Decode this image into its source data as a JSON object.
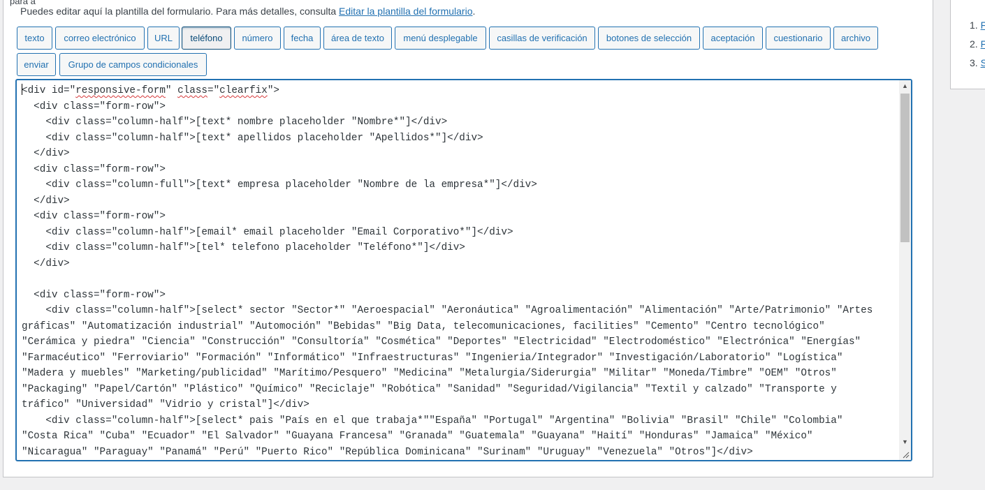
{
  "intro": {
    "text": "Puedes editar aquí la plantilla del formulario. Para más detalles, consulta ",
    "link": "Editar la plantilla del formulario",
    "suffix": "."
  },
  "tag_buttons": [
    {
      "label": "texto"
    },
    {
      "label": "correo electrónico"
    },
    {
      "label": "URL"
    },
    {
      "label": "teléfono"
    },
    {
      "label": "número"
    },
    {
      "label": "fecha"
    },
    {
      "label": "área de texto"
    },
    {
      "label": "menú desplegable"
    },
    {
      "label": "casillas de verificación"
    },
    {
      "label": "botones de selección"
    },
    {
      "label": "aceptación"
    },
    {
      "label": "cuestionario"
    },
    {
      "label": "archivo"
    },
    {
      "label": "enviar"
    },
    {
      "label": "Grupo de campos condicionales"
    }
  ],
  "active_button": "teléfono",
  "editor": {
    "first_line": {
      "a": "<div id=\"",
      "b": "responsive-form",
      "c": "\" ",
      "d": "class",
      "e": "=\"",
      "f": "clearfix",
      "g": "\">"
    },
    "lines": [
      "  <div class=\"form-row\">",
      "    <div class=\"column-half\">[text* nombre placeholder \"Nombre*\"]</div>",
      "    <div class=\"column-half\">[text* apellidos placeholder \"Apellidos*\"]</div>",
      "  </div>",
      "  <div class=\"form-row\">",
      "    <div class=\"column-full\">[text* empresa placeholder \"Nombre de la empresa*\"]</div>",
      "  </div>",
      "  <div class=\"form-row\">",
      "    <div class=\"column-half\">[email* email placeholder \"Email Corporativo*\"]</div>",
      "    <div class=\"column-half\">[tel* telefono placeholder \"Teléfono*\"]</div>",
      "  </div>",
      "",
      "  <div class=\"form-row\">",
      "    <div class=\"column-half\">[select* sector \"Sector*\" \"Aeroespacial\" \"Aeronáutica\" \"Agroalimentación\" \"Alimentación\" \"Arte/Patrimonio\" \"Artes",
      "gráficas\" \"Automatización industrial\" \"Automoción\" \"Bebidas\" \"Big Data, telecomunicaciones, facilities\" \"Cemento\" \"Centro tecnológico\"",
      "\"Cerámica y piedra\" \"Ciencia\" \"Construcción\" \"Consultoría\" \"Cosmética\" \"Deportes\" \"Electricidad\" \"Electrodoméstico\" \"Electrónica\" \"Energías\"",
      "\"Farmacéutico\" \"Ferroviario\" \"Formación\" \"Informático\" \"Infraestructuras\" \"Ingenieria/Integrador\" \"Investigación/Laboratorio\" \"Logística\"",
      "\"Madera y muebles\" \"Marketing/publicidad\" \"Marítimo/Pesquero\" \"Medicina\" \"Metalurgia/Siderurgia\" \"Militar\" \"Moneda/Timbre\" \"OEM\" \"Otros\"",
      "\"Packaging\" \"Papel/Cartón\" \"Plástico\" \"Químico\" \"Reciclaje\" \"Robótica\" \"Sanidad\" \"Seguridad/Vigilancia\" \"Textil y calzado\" \"Transporte y",
      "tráfico\" \"Universidad\" \"Vidrio y cristal\"]</div>",
      "    <div class=\"column-half\">[select* pais \"País en el que trabaja*\"\"España\" \"Portugal\" \"Argentina\" \"Bolivia\" \"Brasil\" \"Chile\" \"Colombia\"",
      "\"Costa Rica\" \"Cuba\" \"Ecuador\" \"El Salvador\" \"Guayana Francesa\" \"Granada\" \"Guatemala\" \"Guayana\" \"Haití\" \"Honduras\" \"Jamaica\" \"México\"",
      "\"Nicaragua\" \"Paraguay\" \"Panamá\" \"Perú\" \"Puerto Rico\" \"República Dominicana\" \"Surinam\" \"Uruguay\" \"Venezuela\" \"Otros\"]</div>"
    ]
  },
  "sidebar": {
    "top_text": "para a",
    "items": [
      {
        "num": "1.",
        "link": "F"
      },
      {
        "num": "2.",
        "link": "F"
      },
      {
        "num": "3.",
        "link": "S"
      }
    ]
  }
}
